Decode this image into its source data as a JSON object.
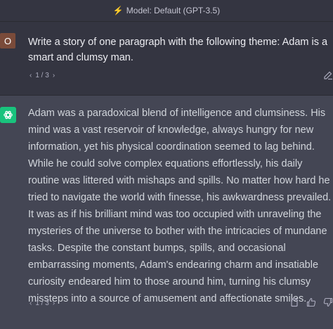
{
  "header": {
    "model_label": "Model: Default (GPT-3.5)",
    "icon": "bolt-icon"
  },
  "user_message": {
    "avatar_letter": "O",
    "avatar_color": "#7a4b3a",
    "text": "Write a story of one paragraph with the following theme: Adam is a smart and clumsy man.",
    "pager": {
      "prev": "‹",
      "count": "1 / 3",
      "next": "›"
    },
    "edit_icon": "edit-icon"
  },
  "assistant_message": {
    "avatar_icon": "openai-logo-icon",
    "avatar_color": "#19c37d",
    "text": "Adam was a paradoxical blend of intelligence and clumsiness. His mind was a vast reservoir of knowledge, always hungry for new information, yet his physical coordination seemed to lag behind. While he could solve complex equations effortlessly, his daily routine was littered with mishaps and spills. No matter how hard he tried to navigate the world with finesse, his awkwardness prevailed. It was as if his brilliant mind was too occupied with unraveling the mysteries of the universe to bother with the intricacies of mundane tasks. Despite the constant bumps, spills, and occasional embarrassing moments, Adam's endearing charm and insatiable curiosity endeared him to those around him, turning his clumsy missteps into a source of amusement and affectionate smiles.",
    "pager": {
      "prev": "‹",
      "count": "1 / 3",
      "next": "›"
    },
    "action_icons": [
      "copy-icon",
      "thumbs-up-icon",
      "thumbs-down-icon"
    ]
  }
}
